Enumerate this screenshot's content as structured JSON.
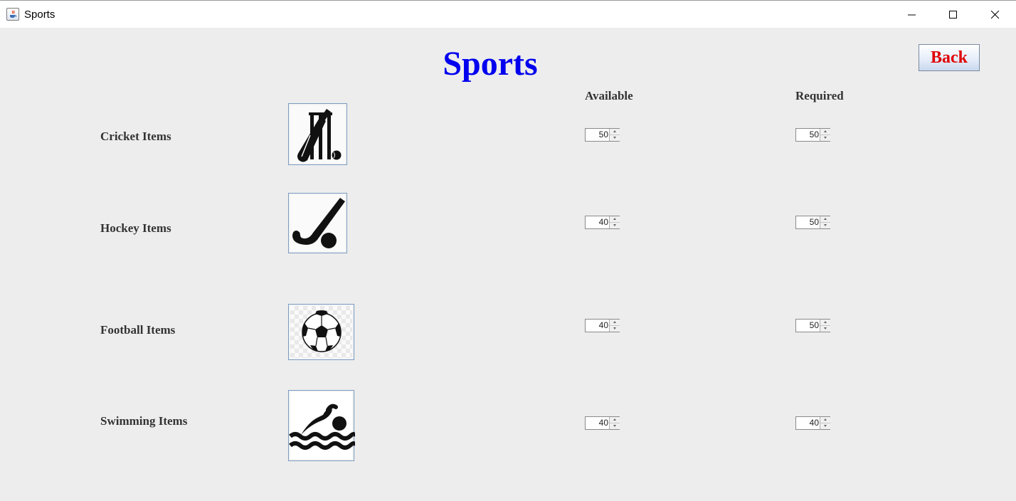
{
  "window": {
    "title": "Sports",
    "icon": "java-cup-icon"
  },
  "page": {
    "heading": "Sports",
    "back_label": "Back"
  },
  "columns": {
    "available": "Available",
    "required": "Required"
  },
  "items": [
    {
      "label": "Cricket Items",
      "icon": "cricket-icon",
      "available": "50",
      "required": "50"
    },
    {
      "label": "Hockey Items",
      "icon": "hockey-icon",
      "available": "40",
      "required": "50"
    },
    {
      "label": "Football Items",
      "icon": "football-icon",
      "available": "40",
      "required": "50"
    },
    {
      "label": "Swimming Items",
      "icon": "swimming-icon",
      "available": "40",
      "required": "40"
    }
  ],
  "colors": {
    "heading": "#0000ee",
    "back_text": "#e00000",
    "background": "#ededed"
  }
}
